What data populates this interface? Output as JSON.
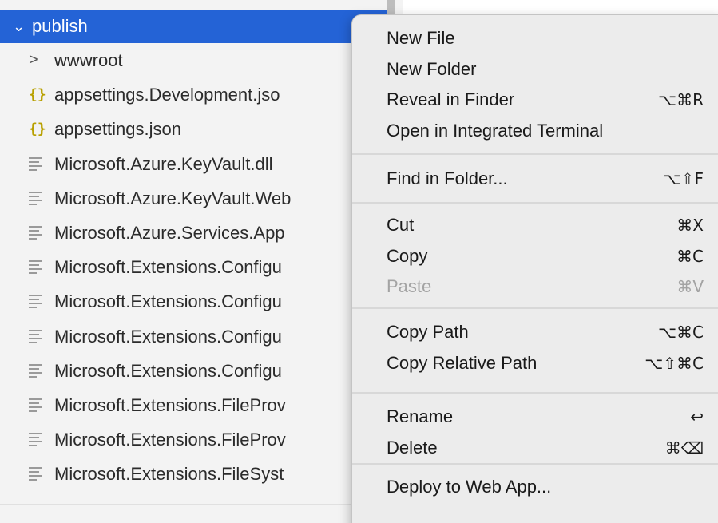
{
  "explorer": {
    "folder": {
      "chevron_icon": "chevron-down-icon",
      "label": "publish"
    },
    "items": [
      {
        "icon": "chevron-right-icon",
        "glyph": ">",
        "label": "wwwroot"
      },
      {
        "icon": "json-icon",
        "glyph": "{}",
        "label": "appsettings.Development.jso"
      },
      {
        "icon": "json-icon",
        "glyph": "{}",
        "label": "appsettings.json"
      },
      {
        "icon": "file-lines-icon",
        "glyph": "",
        "label": "Microsoft.Azure.KeyVault.dll"
      },
      {
        "icon": "file-lines-icon",
        "glyph": "",
        "label": "Microsoft.Azure.KeyVault.Web"
      },
      {
        "icon": "file-lines-icon",
        "glyph": "",
        "label": "Microsoft.Azure.Services.App"
      },
      {
        "icon": "file-lines-icon",
        "glyph": "",
        "label": "Microsoft.Extensions.Configu"
      },
      {
        "icon": "file-lines-icon",
        "glyph": "",
        "label": "Microsoft.Extensions.Configu"
      },
      {
        "icon": "file-lines-icon",
        "glyph": "",
        "label": "Microsoft.Extensions.Configu"
      },
      {
        "icon": "file-lines-icon",
        "glyph": "",
        "label": "Microsoft.Extensions.Configu"
      },
      {
        "icon": "file-lines-icon",
        "glyph": "",
        "label": "Microsoft.Extensions.FileProv"
      },
      {
        "icon": "file-lines-icon",
        "glyph": "",
        "label": "Microsoft.Extensions.FileProv"
      },
      {
        "icon": "file-lines-icon",
        "glyph": "",
        "label": "Microsoft.Extensions.FileSyst"
      }
    ]
  },
  "context_menu": {
    "groups": [
      {
        "items": [
          {
            "label": "New File",
            "shortcut": ""
          },
          {
            "label": "New Folder",
            "shortcut": ""
          },
          {
            "label": "Reveal in Finder",
            "shortcut": "⌥⌘R"
          },
          {
            "label": "Open in Integrated Terminal",
            "shortcut": ""
          }
        ]
      },
      {
        "items": [
          {
            "label": "Find in Folder...",
            "shortcut": "⌥⇧F"
          }
        ]
      },
      {
        "items": [
          {
            "label": "Cut",
            "shortcut": "⌘X"
          },
          {
            "label": "Copy",
            "shortcut": "⌘C"
          },
          {
            "label": "Paste",
            "shortcut": "⌘V",
            "disabled": true
          }
        ]
      },
      {
        "items": [
          {
            "label": "Copy Path",
            "shortcut": "⌥⌘C"
          },
          {
            "label": "Copy Relative Path",
            "shortcut": "⌥⇧⌘C"
          }
        ]
      },
      {
        "items": [
          {
            "label": "Rename",
            "shortcut": "↩"
          },
          {
            "label": "Delete",
            "shortcut": "⌘⌫"
          }
        ]
      },
      {
        "items": [
          {
            "label": "Deploy to Web App...",
            "shortcut": ""
          }
        ]
      }
    ]
  },
  "colors": {
    "selection": "#2463d6",
    "explorer_bg": "#f3f3f3",
    "menu_bg": "#ececec",
    "json_icon": "#b8a000",
    "disabled_text": "#a3a3a3"
  }
}
